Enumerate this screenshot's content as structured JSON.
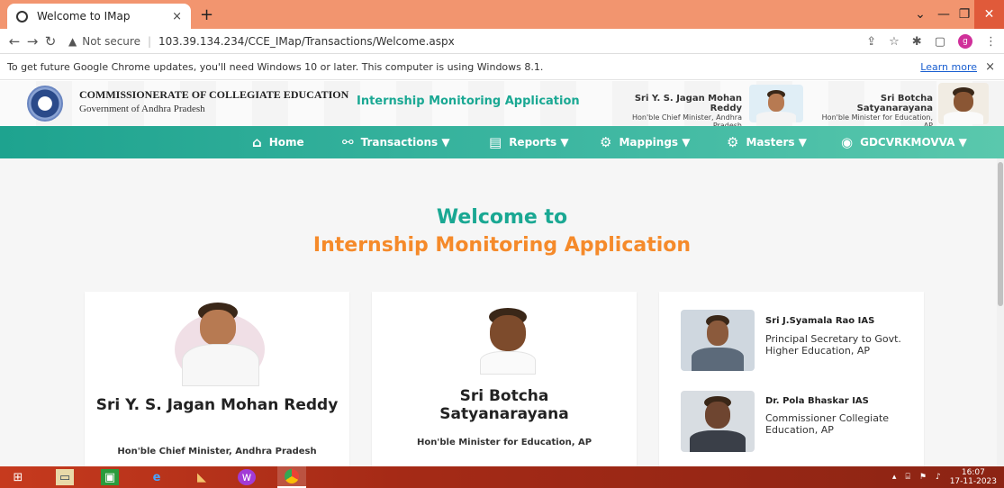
{
  "browser": {
    "tab_title": "Welcome to IMap",
    "tab_close": "×",
    "new_tab": "+",
    "url_warning": "Not secure",
    "url": "103.39.134.234/CCE_IMap/Transactions/Welcome.aspx",
    "profile_letter": "g",
    "info_message": "To get future Google Chrome updates, you'll need Windows 10 or later. This computer is using Windows 8.1.",
    "info_link": "Learn more",
    "info_close": "×"
  },
  "header": {
    "org_name": "COMMISSIONERATE OF COLLEGIATE EDUCATION",
    "org_sub": "Government of Andhra Pradesh",
    "app_name": "Internship Monitoring Application",
    "cm_name": "Sri Y. S. Jagan Mohan Reddy",
    "cm_role": "Hon'ble Chief Minister, Andhra Pradesh",
    "min_name": "Sri Botcha Satyanarayana",
    "min_role": "Hon'ble Minister for Education, AP"
  },
  "nav": {
    "home": "Home",
    "transactions": "Transactions ▼",
    "reports": "Reports ▼",
    "mappings": "Mappings ▼",
    "masters": "Masters ▼",
    "user": "GDCVRKMOVVA ▼"
  },
  "main": {
    "welcome_line1": "Welcome to",
    "welcome_line2": "Internship Monitoring Application",
    "card1": {
      "name": "Sri Y. S. Jagan Mohan Reddy",
      "role": "Hon'ble Chief Minister, Andhra Pradesh"
    },
    "card2": {
      "name": "Sri Botcha Satyanarayana",
      "role": "Hon'ble Minister for Education, AP"
    },
    "officials": [
      {
        "name": "Sri J.Syamala Rao IAS",
        "role": "Principal Secretary to Govt. Higher Education, AP"
      },
      {
        "name": "Dr. Pola Bhaskar IAS",
        "role": "Commissioner Collegiate Education, AP"
      }
    ]
  },
  "taskbar": {
    "time": "16:07",
    "date": "17-11-2023"
  },
  "colors": {
    "accent_teal": "#1aa893",
    "accent_orange": "#f58a2a",
    "tabstrip": "#f2956f",
    "taskbar": "#a52a16"
  }
}
